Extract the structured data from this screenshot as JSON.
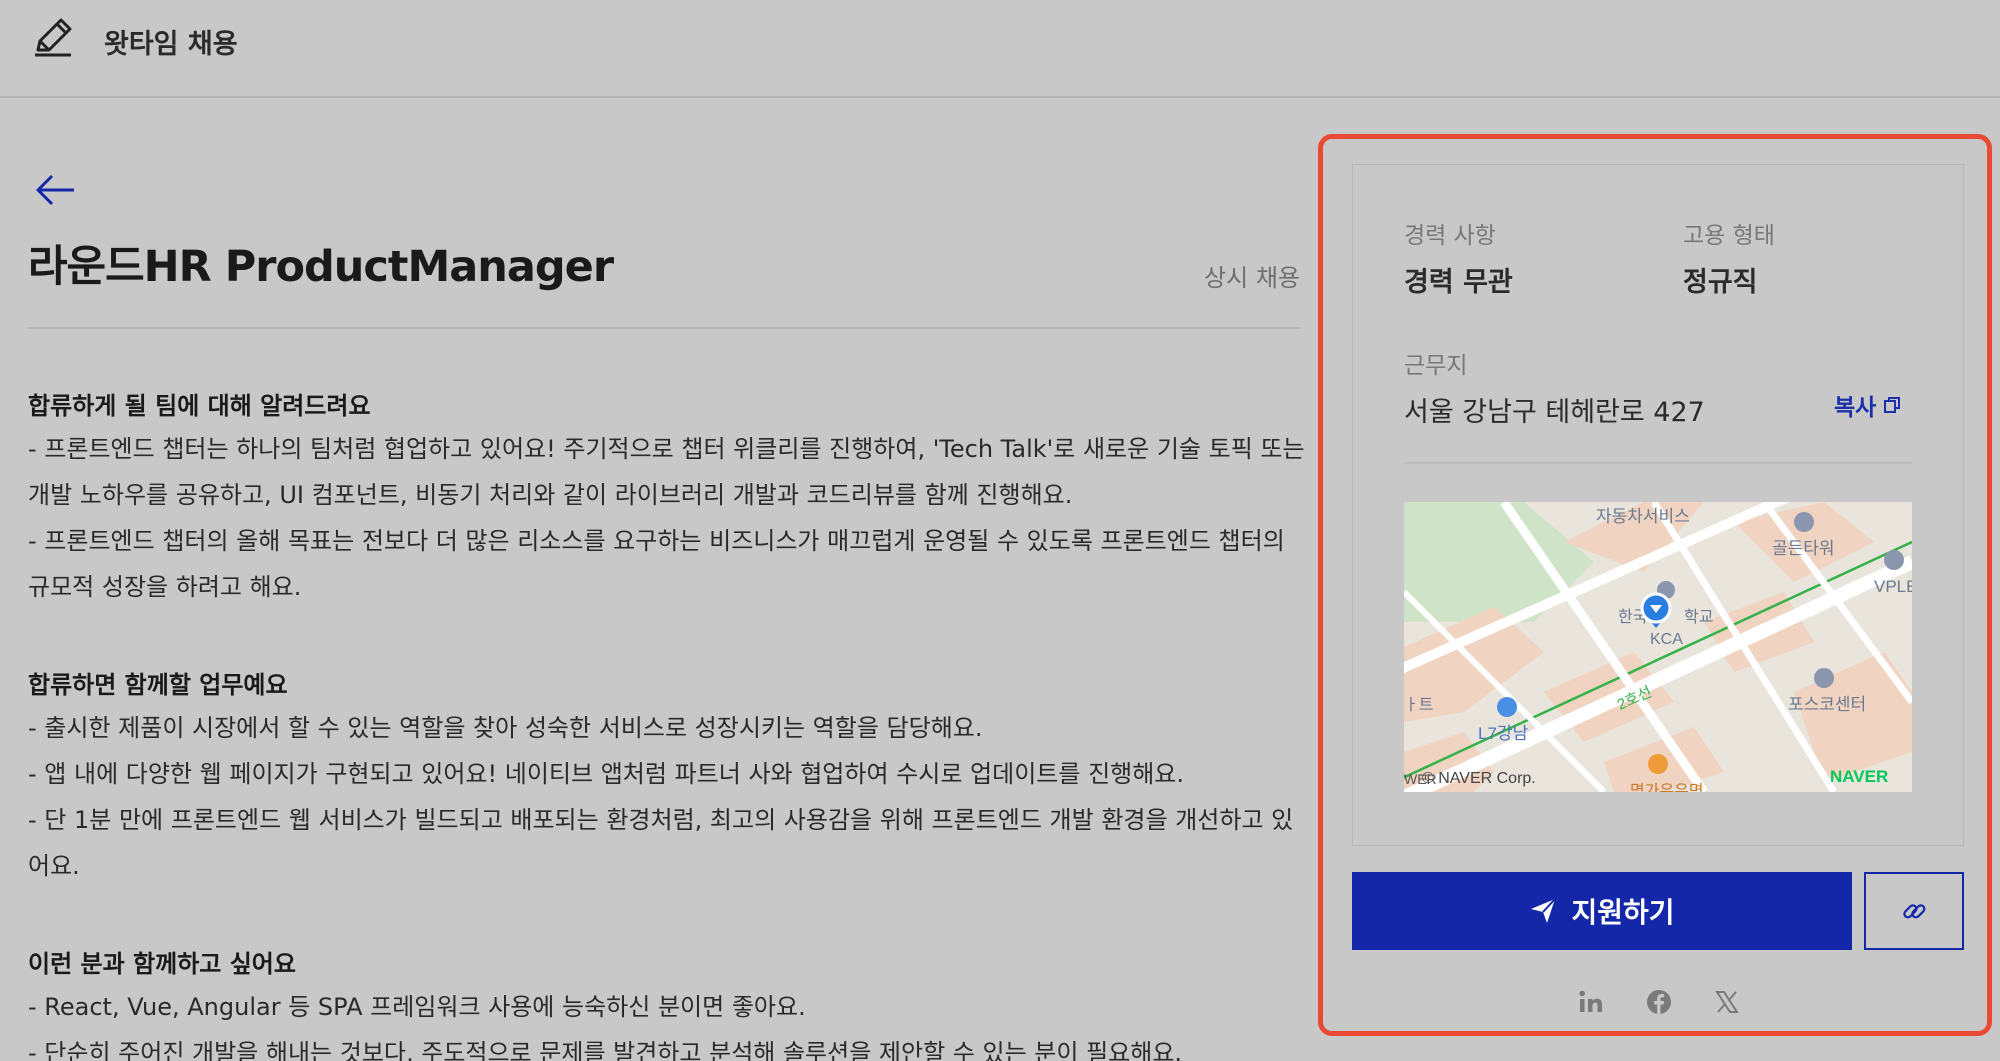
{
  "header": {
    "brand_name": "왓타임 채용"
  },
  "job": {
    "title": "라운드HR ProductManager",
    "hire_type": "상시 채용"
  },
  "sections": [
    {
      "heading": "합류하게 될 팀에 대해 알려드려요",
      "lines": [
        "- 프론트엔드 챕터는 하나의 팀처럼 협업하고 있어요! 주기적으로 챕터 위클리를 진행하여, 'Tech Talk'로 새로운 기술 토픽 또는",
        "개발 노하우를 공유하고, UI 컴포넌트, 비동기 처리와 같이 라이브러리 개발과 코드리뷰를 함께 진행해요.",
        "- 프론트엔드 챕터의 올해 목표는 전보다 더 많은 리소스를 요구하는 비즈니스가 매끄럽게 운영될 수 있도록 프론트엔드 챕터의",
        "규모적 성장을 하려고 해요."
      ]
    },
    {
      "heading": "합류하면 함께할 업무예요",
      "lines": [
        "- 출시한 제품이 시장에서 할 수 있는 역할을 찾아 성숙한 서비스로 성장시키는 역할을 담당해요.",
        "- 앱 내에 다양한 웹 페이지가 구현되고 있어요! 네이티브 앱처럼 파트너 사와 협업하여 수시로 업데이트를 진행해요.",
        "- 단 1분 만에 프론트엔드 웹 서비스가 빌드되고 배포되는 환경처럼, 최고의 사용감을 위해 프론트엔드 개발 환경을 개선하고 있",
        "어요."
      ]
    },
    {
      "heading": "이런 분과 함께하고 싶어요",
      "lines": [
        "- React, Vue, Angular 등 SPA 프레임워크 사용에 능숙하신 분이면 좋아요.",
        "- 단순히 주어진 개발을 해내는 것보다, 주도적으로 문제를 발견하고 분석해 솔루션을 제안할 수 있는 분이 필요해요."
      ]
    }
  ],
  "summary": {
    "career_label": "경력 사항",
    "career_value": "경력 무관",
    "employment_label": "고용 형태",
    "employment_value": "정규직",
    "location_label": "근무지",
    "location_value": "서울 강남구 테헤란로 427",
    "copy_label": "복사"
  },
  "map": {
    "labels": {
      "car_service": "자동차서비스",
      "golden_tower": "골든타워",
      "vple": "VPLE",
      "school": "한국",
      "school2": "학교",
      "kca": "KCA",
      "line2": "2호선",
      "posco": "포스코센터",
      "l7": "L7강남",
      "left_edge": "ㅏ트",
      "naver_corp": "© NAVER Corp.",
      "naver": "NAVER",
      "wer": "WER",
      "bottom": "명가유유면"
    }
  },
  "actions": {
    "apply_label": "지원하기"
  },
  "icons": {
    "brand": "pencil-icon",
    "back": "arrow-left-icon",
    "copy": "copy-icon",
    "apply": "paper-plane-icon",
    "link": "link-icon",
    "linkedin": "linkedin-icon",
    "facebook": "facebook-icon",
    "x": "x-icon"
  },
  "colors": {
    "background": "#c8c8c8",
    "primary": "#1327a8",
    "highlight": "#ea4a35",
    "map_line": "#33b249"
  }
}
